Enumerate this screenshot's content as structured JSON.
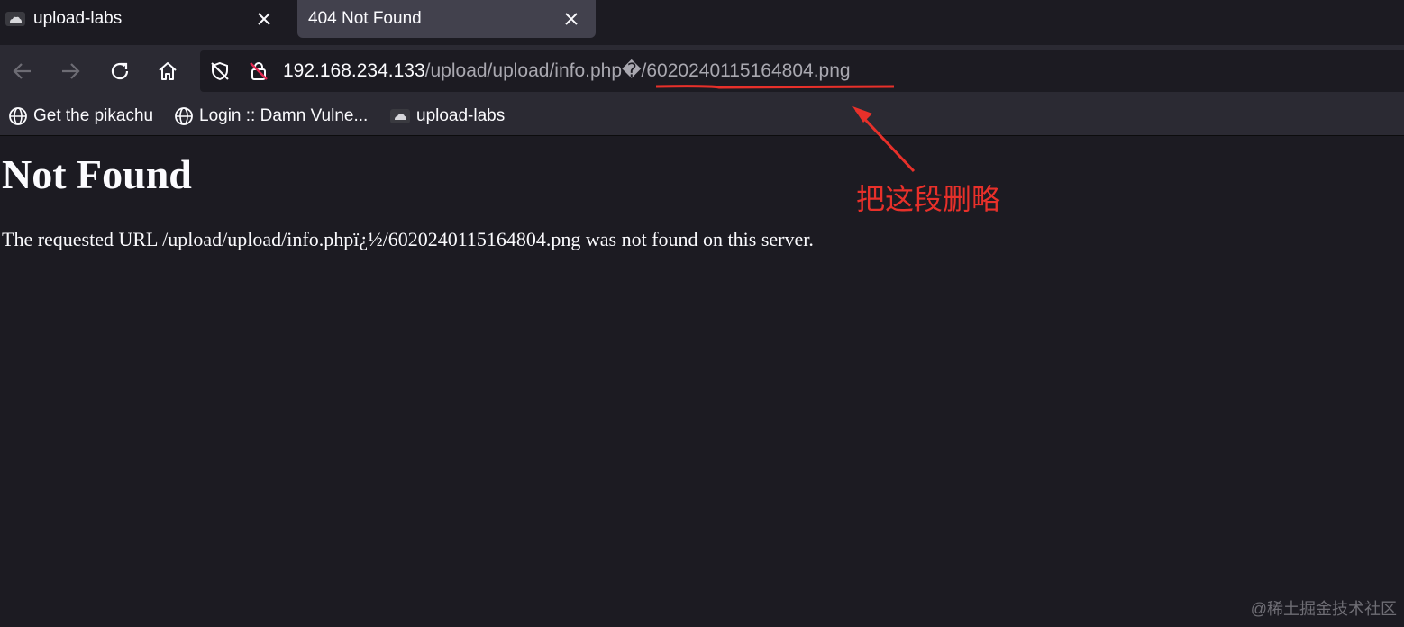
{
  "tabs": [
    {
      "title": "upload-labs",
      "active": false,
      "favicon": "cloud-favicon-icon"
    },
    {
      "title": "404 Not Found",
      "active": true
    }
  ],
  "navbar": {
    "url_host": "192.168.234.133",
    "url_path": "/upload/upload/info.php�/6020240115164804.png",
    "icons": [
      "back-arrow-icon",
      "forward-arrow-icon",
      "reload-icon",
      "home-icon",
      "tracking-protection-icon",
      "insecure-lock-icon"
    ]
  },
  "bookmarks": [
    {
      "label": "Get the pikachu",
      "icon": "globe-icon"
    },
    {
      "label": "Login :: Damn Vulne...",
      "icon": "globe-icon"
    },
    {
      "label": "upload-labs",
      "icon": "cloud-favicon-icon"
    }
  ],
  "page": {
    "heading": "Not Found",
    "message": "The requested URL /upload/upload/info.phpï¿½/6020240115164804.png was not found on this server."
  },
  "annotation": {
    "text": "把这段删略",
    "color": "#e8302a"
  },
  "watermark": "@稀土掘金技术社区",
  "colors": {
    "background": "#1c1b22",
    "toolbar": "#2b2a33",
    "active_tab": "#42414d",
    "annotation_red": "#e8302a"
  }
}
